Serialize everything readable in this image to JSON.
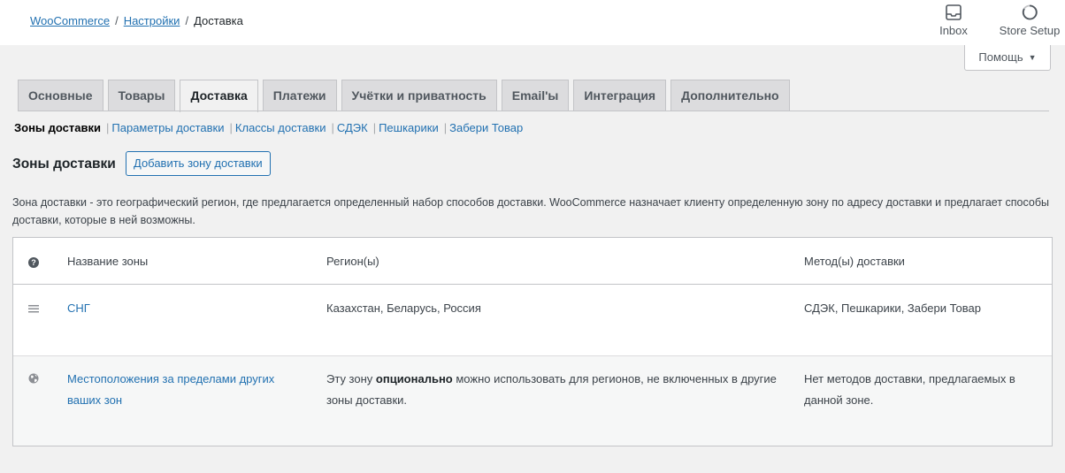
{
  "breadcrumb": {
    "woocommerce": "WooCommerce",
    "settings": "Настройки",
    "current": "Доставка",
    "separator": "/"
  },
  "toolbar": {
    "inbox_label": "Inbox",
    "inbox_icon": "inbox-icon",
    "setup_label": "Store Setup",
    "setup_icon": "progress-ring-icon"
  },
  "help": {
    "label": "Помощь",
    "arrow": "▼"
  },
  "tabs": [
    {
      "label": "Основные"
    },
    {
      "label": "Товары"
    },
    {
      "label": "Доставка",
      "active": true
    },
    {
      "label": "Платежи"
    },
    {
      "label": "Учётки и приватность"
    },
    {
      "label": "Email'ы"
    },
    {
      "label": "Интеграция"
    },
    {
      "label": "Дополнительно"
    }
  ],
  "subnav": {
    "current": "Зоны доставки",
    "sep": "|",
    "links": [
      "Параметры доставки",
      "Классы доставки",
      "СДЭК",
      "Пешкарики",
      "Забери Товар"
    ]
  },
  "section": {
    "title": "Зоны доставки",
    "add_button": "Добавить зону доставки",
    "description": "Зона доставки - это географический регион, где предлагается определенный набор способов доставки. WooCommerce назначает клиенту определенную зону по адресу доставки и предлагает способы доставки, которые в ней возможны."
  },
  "table": {
    "headers": {
      "help_icon": "?",
      "name": "Название зоны",
      "regions": "Регион(ы)",
      "methods": "Метод(ы) доставки"
    },
    "rows": [
      {
        "icon": "drag-handle-icon",
        "name": "СНГ",
        "regions": "Казахстан, Беларусь, Россия",
        "methods": "СДЭК, Пешкарики, Забери Товар"
      }
    ],
    "rest": {
      "icon": "globe-icon",
      "name": "Местоположения за пределами других ваших зон",
      "regions_before": "Эту зону ",
      "regions_bold": "опционально",
      "regions_after": " можно использовать для регионов, не включенных в другие зоны доставки.",
      "methods": "Нет методов доставки, предлагаемых в данной зоне."
    }
  }
}
